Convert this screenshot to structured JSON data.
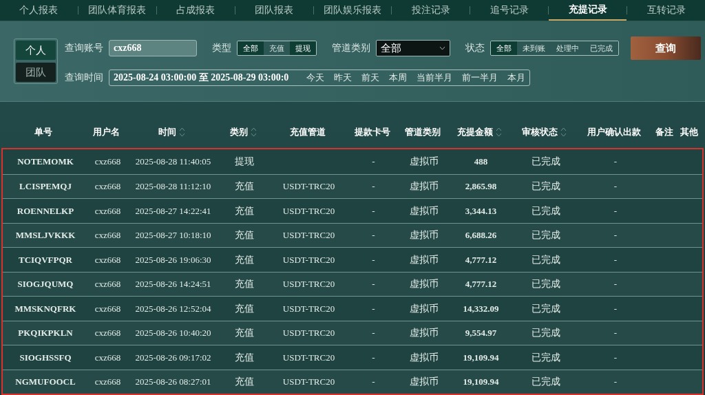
{
  "tabs": [
    {
      "label": "个人报表",
      "selected": false
    },
    {
      "label": "团队体育报表",
      "selected": false
    },
    {
      "label": "占成报表",
      "selected": false
    },
    {
      "label": "团队报表",
      "selected": false
    },
    {
      "label": "团队娱乐报表",
      "selected": false
    },
    {
      "label": "投注记录",
      "selected": false
    },
    {
      "label": "追号记录",
      "selected": false
    },
    {
      "label": "充提记录",
      "selected": true
    },
    {
      "label": "互转记录",
      "selected": false
    }
  ],
  "scope": [
    {
      "label": "个人",
      "selected": true
    },
    {
      "label": "团队",
      "selected": false
    }
  ],
  "filters": {
    "account_label": "查询账号",
    "account_value": "cxz668",
    "type_label": "类型",
    "types": [
      {
        "label": "全部",
        "selected": true
      },
      {
        "label": "充值",
        "selected": false
      },
      {
        "label": "提现",
        "selected": true
      }
    ],
    "channel_label": "管道类别",
    "channel_value": "全部",
    "status_label": "状态",
    "statuses": [
      {
        "label": "全部",
        "selected": true
      },
      {
        "label": "未到账",
        "selected": false
      },
      {
        "label": "处理中",
        "selected": false
      },
      {
        "label": "已完成",
        "selected": false
      }
    ],
    "search_button": "查询",
    "time_label": "查询时间",
    "time_value": "2025-08-24 03:00:00 至 2025-08-29 03:00:0",
    "quick_ranges": [
      "今天",
      "昨天",
      "前天",
      "本周",
      "当前半月",
      "前一半月",
      "本月"
    ]
  },
  "table": {
    "columns": [
      {
        "label": "单号",
        "sortable": false
      },
      {
        "label": "用户名",
        "sortable": false
      },
      {
        "label": "时间",
        "sortable": true
      },
      {
        "label": "类别",
        "sortable": true
      },
      {
        "label": "充值管道",
        "sortable": false
      },
      {
        "label": "提款卡号",
        "sortable": false
      },
      {
        "label": "管道类别",
        "sortable": false
      },
      {
        "label": "充提金额",
        "sortable": true
      },
      {
        "label": "审核状态",
        "sortable": true
      },
      {
        "label": "用户确认出款",
        "sortable": false
      },
      {
        "label": "备注",
        "sortable": false
      },
      {
        "label": "其他",
        "sortable": false
      }
    ],
    "rows": [
      [
        "NOTEMOMK",
        "cxz668",
        "2025-08-28 11:40:05",
        "提现",
        "",
        "-",
        "虚拟币",
        "488",
        "已完成",
        "-",
        "",
        ""
      ],
      [
        "LCISPEMQJ",
        "cxz668",
        "2025-08-28 11:12:10",
        "充值",
        "USDT-TRC20",
        "-",
        "虚拟币",
        "2,865.98",
        "已完成",
        "-",
        "",
        ""
      ],
      [
        "ROENNELKP",
        "cxz668",
        "2025-08-27 14:22:41",
        "充值",
        "USDT-TRC20",
        "-",
        "虚拟币",
        "3,344.13",
        "已完成",
        "-",
        "",
        ""
      ],
      [
        "MMSLJVKKK",
        "cxz668",
        "2025-08-27 10:18:10",
        "充值",
        "USDT-TRC20",
        "-",
        "虚拟币",
        "6,688.26",
        "已完成",
        "-",
        "",
        ""
      ],
      [
        "TCIQVFPQR",
        "cxz668",
        "2025-08-26 19:06:30",
        "充值",
        "USDT-TRC20",
        "-",
        "虚拟币",
        "4,777.12",
        "已完成",
        "-",
        "",
        ""
      ],
      [
        "SIOGJQUMQ",
        "cxz668",
        "2025-08-26 14:24:51",
        "充值",
        "USDT-TRC20",
        "-",
        "虚拟币",
        "4,777.12",
        "已完成",
        "-",
        "",
        ""
      ],
      [
        "MMSKNQFRK",
        "cxz668",
        "2025-08-26 12:52:04",
        "充值",
        "USDT-TRC20",
        "-",
        "虚拟币",
        "14,332.09",
        "已完成",
        "-",
        "",
        ""
      ],
      [
        "PKQIKPKLN",
        "cxz668",
        "2025-08-26 10:40:20",
        "充值",
        "USDT-TRC20",
        "-",
        "虚拟币",
        "9,554.97",
        "已完成",
        "-",
        "",
        ""
      ],
      [
        "SIOGHSSFQ",
        "cxz668",
        "2025-08-26 09:17:02",
        "充值",
        "USDT-TRC20",
        "-",
        "虚拟币",
        "19,109.94",
        "已完成",
        "-",
        "",
        ""
      ],
      [
        "NGMUFOOCL",
        "cxz668",
        "2025-08-26 08:27:01",
        "充值",
        "USDT-TRC20",
        "-",
        "虚拟币",
        "19,109.94",
        "已完成",
        "-",
        "",
        ""
      ]
    ]
  }
}
